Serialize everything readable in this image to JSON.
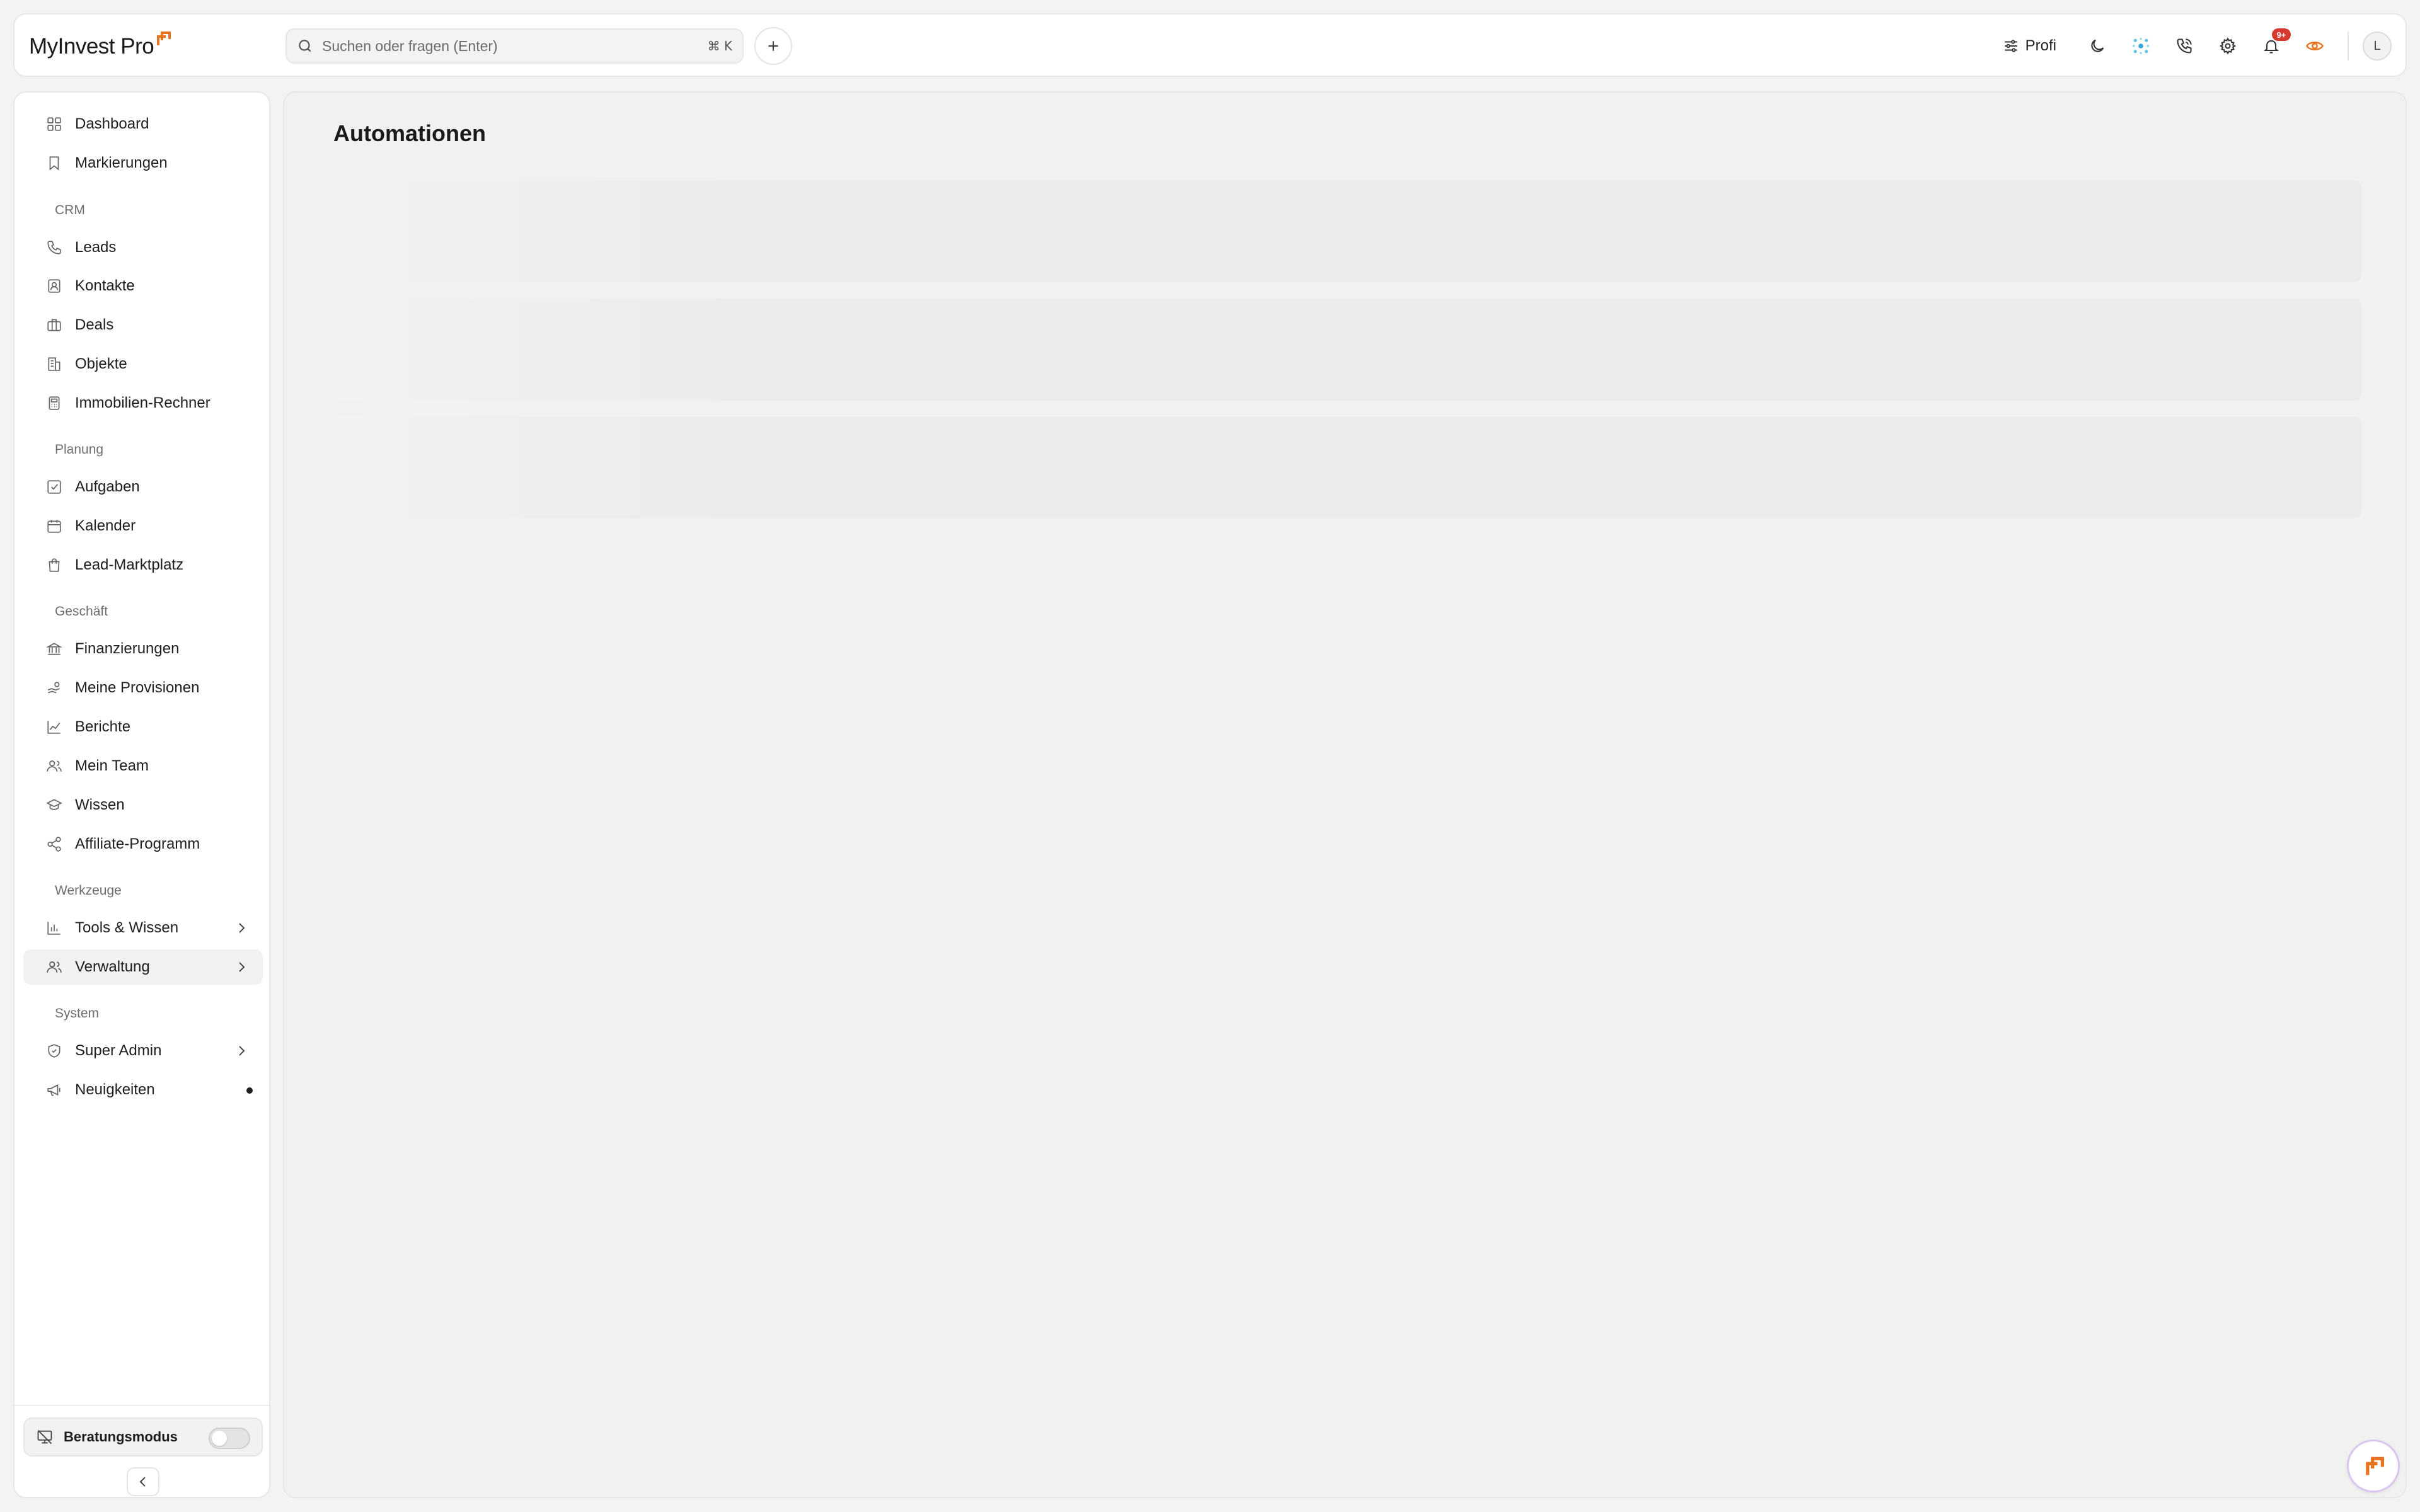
{
  "app": {
    "name": "MyInvest Pro",
    "brand_color": "#e8741f"
  },
  "header": {
    "search_placeholder": "Suchen oder fragen (Enter)",
    "search_shortcut": "⌘ K",
    "profile_mode_label": "Profi",
    "notifications_badge": "9+",
    "avatar_initial": "L"
  },
  "sidebar": {
    "items": [
      {
        "label": "Dashboard"
      },
      {
        "label": "Markierungen"
      }
    ],
    "sections": {
      "crm": "CRM",
      "planung": "Planung",
      "geschaeft": "Geschäft",
      "werkzeuge": "Werkzeuge",
      "system": "System"
    },
    "crm_items": [
      {
        "label": "Leads"
      },
      {
        "label": "Kontakte"
      },
      {
        "label": "Deals"
      },
      {
        "label": "Objekte"
      },
      {
        "label": "Immobilien-Rechner"
      }
    ],
    "planung_items": [
      {
        "label": "Aufgaben"
      },
      {
        "label": "Kalender"
      },
      {
        "label": "Lead-Marktplatz"
      }
    ],
    "geschaeft_items": [
      {
        "label": "Finanzierungen"
      },
      {
        "label": "Meine Provisionen"
      },
      {
        "label": "Berichte"
      },
      {
        "label": "Mein Team"
      },
      {
        "label": "Wissen"
      },
      {
        "label": "Affiliate-Programm"
      }
    ],
    "werkzeuge_items": [
      {
        "label": "Tools & Wissen"
      },
      {
        "label": "Verwaltung"
      }
    ],
    "system_items": [
      {
        "label": "Super Admin"
      },
      {
        "label": "Neuigkeiten"
      }
    ],
    "consulting_mode_label": "Beratungsmodus"
  },
  "main": {
    "title": "Automationen"
  }
}
